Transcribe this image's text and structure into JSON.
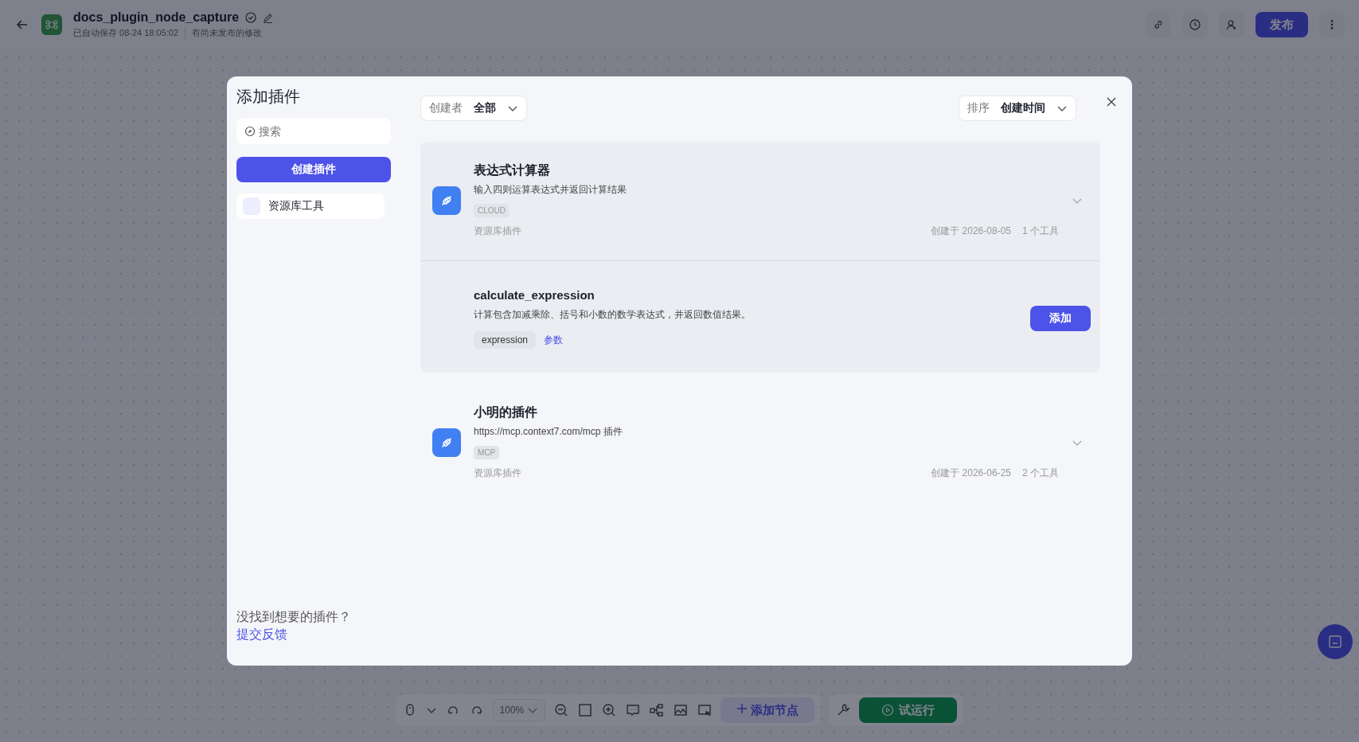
{
  "topbar": {
    "title": "docs_plugin_node_capture",
    "saved_status": "已自动保存 08-24 18:05:02",
    "unsaved_note": "有尚未发布的修改",
    "publish_label": "发布"
  },
  "modal": {
    "title": "添加插件",
    "search": {
      "placeholder": "搜索"
    },
    "create_button": "创建插件",
    "categories": [
      {
        "label": "资源库工具"
      }
    ],
    "footer_text": "没找到想要的插件？",
    "footer_link": "提交反馈",
    "creator_filter": {
      "label": "创建者",
      "value": "全部"
    },
    "sort_filter": {
      "label": "排序",
      "value": "创建时间"
    },
    "plugins": [
      {
        "name": "表达式计算器",
        "description": "输入四则运算表达式并返回计算结果",
        "tag": "CLOUD",
        "source": "资源库插件",
        "created": "创建于 2026-08-05",
        "tool_count": "1 个工具",
        "tools": [
          {
            "name": "calculate_expression",
            "description": "计算包含加减乘除、括号和小数的数学表达式，并返回数值结果。",
            "params": [
              "expression"
            ],
            "params_link": "参数",
            "add_label": "添加"
          }
        ]
      },
      {
        "name": "小明的插件",
        "description": "https://mcp.context7.com/mcp 插件",
        "tag": "MCP",
        "source": "资源库插件",
        "created": "创建于 2026-06-25",
        "tool_count": "2 个工具"
      }
    ]
  },
  "toolbar": {
    "zoom": "100%",
    "add_node": "添加节点",
    "run": "试运行"
  }
}
